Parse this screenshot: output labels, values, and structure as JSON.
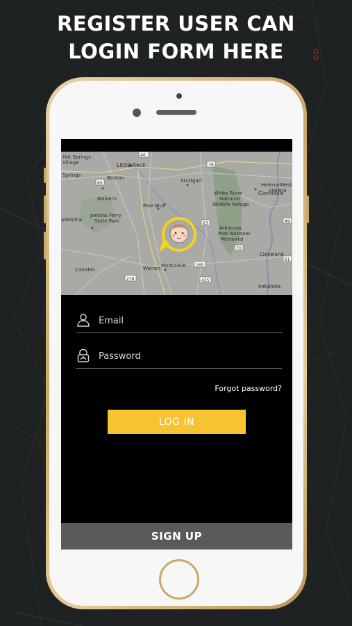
{
  "promo": {
    "headline_line1": "REGISTER USER CAN",
    "headline_line2": "LOGIN FORM HERE"
  },
  "map": {
    "labels": [
      "Hot Springs",
      "Village",
      "Springs",
      "Little Rock",
      "Benton",
      "Stuttgart",
      "Helena-West",
      "Helena",
      "Clarksdale",
      "Malvern",
      "Pine Bluff",
      "Jenkins Ferry",
      "State Park",
      "White River",
      "National",
      "Wildlife Refuge",
      "Arkansas",
      "Post National",
      "Memorial",
      "adelphia",
      "Camden",
      "Warren",
      "Monticello",
      "Cleveland",
      "Indianola"
    ],
    "road_shields": [
      "40",
      "79",
      "65",
      "63",
      "70",
      "278",
      "165",
      "49",
      "61",
      "425"
    ]
  },
  "form": {
    "email_placeholder": "Email",
    "password_placeholder": "Password",
    "forgot_label": "Forgot password?",
    "login_label": "LOG IN",
    "signup_label": "SIGN UP"
  },
  "icons": {
    "email": "user-icon",
    "password": "lock-icon",
    "map_marker": "child-location-pin-icon"
  },
  "colors": {
    "accent": "#f5c430",
    "screen_background": "#000000",
    "signup_background": "#5a5a5a",
    "page_background": "#1f2223"
  }
}
